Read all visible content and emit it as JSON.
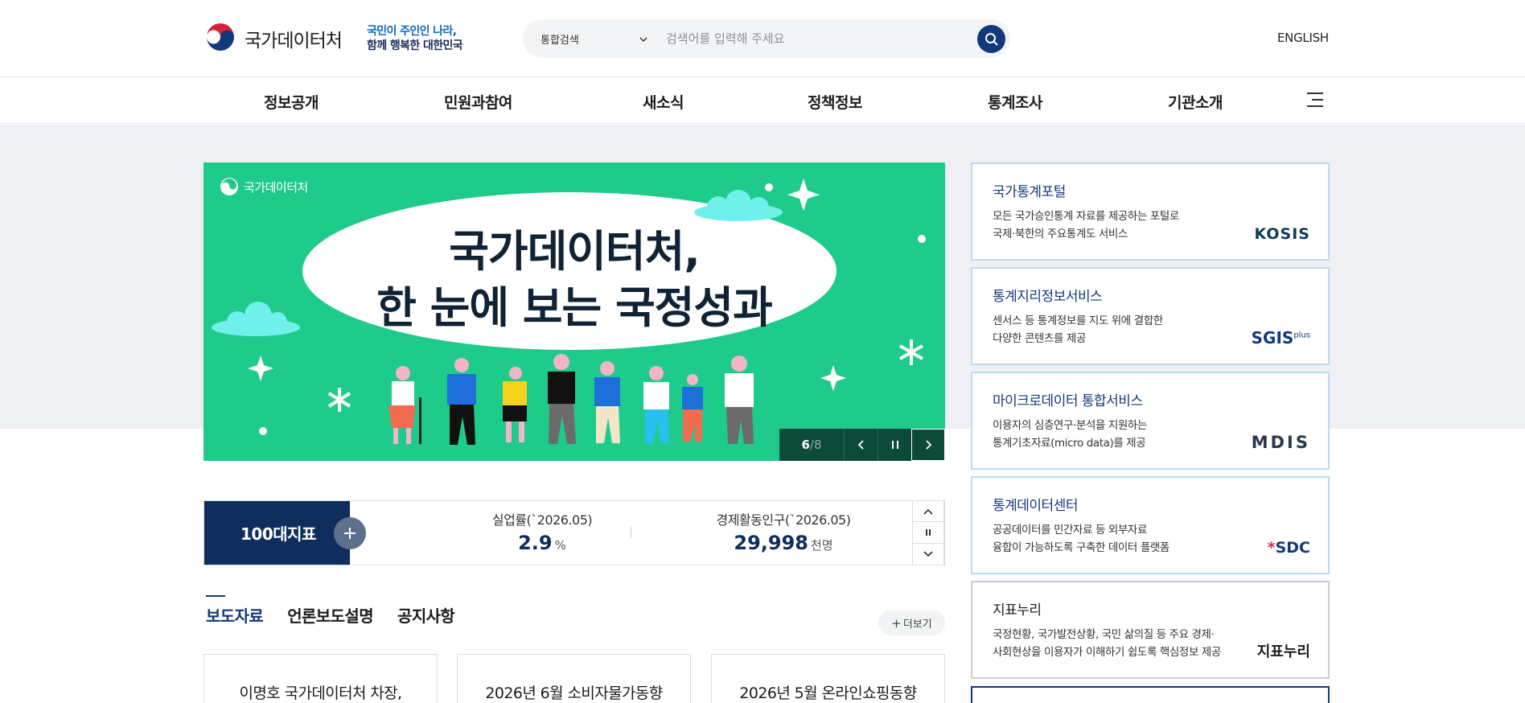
{
  "header": {
    "logo_text": "국가데이터처",
    "slogan_line1": "국민이 주인인 나라,",
    "slogan_line2": "함께 행복한 대한민국",
    "search_scope": "통합검색",
    "search_placeholder": "검색어를 입력해 주세요",
    "language_link": "ENGLISH"
  },
  "gnb": {
    "items": [
      "정보공개",
      "민원과참여",
      "새소식",
      "정책정보",
      "통계조사",
      "기관소개"
    ]
  },
  "banner": {
    "logo_text": "국가데이터처",
    "title_line1": "국가데이터처,",
    "title_line2": "한 눈에 보는 국정성과",
    "current_slide": "6",
    "separator": "/",
    "total_slides": "8",
    "colors": {
      "background": "#1fcb8b",
      "control": "#0c4a3a"
    }
  },
  "services": [
    {
      "title": "국가통계포털",
      "desc1": "모든 국가승인통계 자료를 제공하는 포털로",
      "desc2": "국제·북한의 주요통계도 서비스",
      "logo": "KOSIS"
    },
    {
      "title": "통계지리정보서비스",
      "desc1": "센서스 등 통계정보를 지도 위에 결합한",
      "desc2": "다양한 콘텐츠를 제공",
      "logo": "SGIS",
      "logo_sup": "plus"
    },
    {
      "title": "마이크로데이터 통합서비스",
      "desc1": "이용자의 심층연구·분석을 지원하는",
      "desc2": "통계기초자료(micro data)를 제공",
      "logo": "MDIS"
    },
    {
      "title": "통계데이터센터",
      "desc1": "공공데이터를 민간자료 등 외부자료",
      "desc2": "융합이 가능하도록 구축한 데이터 플랫폼",
      "logo": "SDC"
    },
    {
      "title": "지표누리",
      "desc1": "국정현황, 국가발전상황, 국민 삶의질 등 주요 경제·",
      "desc2": "사회현상을 이용자가 이해하기 쉽도록 핵심정보 제공",
      "logo": "지표누리"
    }
  ],
  "indicators": {
    "label": "100대지표",
    "items": [
      {
        "name": "실업률(`2026.05)",
        "value": "2.9",
        "unit": "%"
      },
      {
        "name": "경제활동인구(`2026.05)",
        "value": "29,998",
        "unit": "천명"
      }
    ]
  },
  "news": {
    "tabs": [
      "보도자료",
      "언론보도설명",
      "공지사항"
    ],
    "active_tab": "보도자료",
    "more_label": "더보기",
    "cards": [
      "이명호 국가데이터처 차장,",
      "2026년 6월 소비자물가동향",
      "2026년 5월 온라인쇼핑동향"
    ]
  },
  "icons": [
    "search-icon",
    "chevron-down-icon",
    "hamburger-icon",
    "chevron-left-icon",
    "pause-icon",
    "chevron-right-icon",
    "plus-icon",
    "chevron-up-icon"
  ]
}
